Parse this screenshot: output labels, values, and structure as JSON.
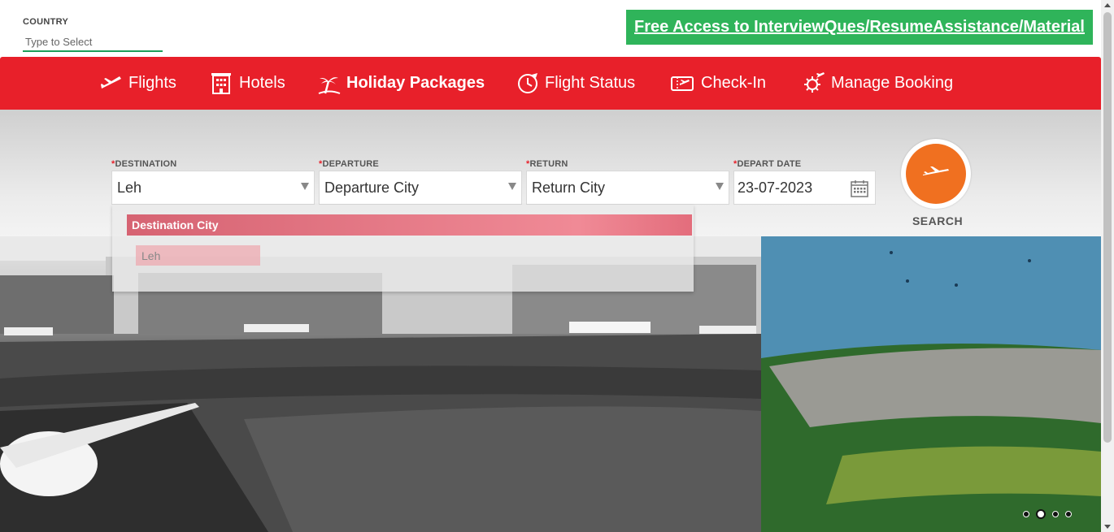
{
  "country": {
    "label": "COUNTRY",
    "placeholder": "Type to Select"
  },
  "promo": {
    "text": "Free Access to InterviewQues/ResumeAssistance/Material"
  },
  "nav": {
    "flights": "Flights",
    "hotels": "Hotels",
    "holiday": "Holiday Packages",
    "flight_status": "Flight Status",
    "checkin": "Check-In",
    "manage": "Manage Booking"
  },
  "form": {
    "destination": {
      "label": "DESTINATION",
      "value": "Leh"
    },
    "departure": {
      "label": "DEPARTURE",
      "value": "Departure City"
    },
    "return": {
      "label": "RETURN",
      "value": "Return City"
    },
    "depart_date": {
      "label": "DEPART DATE",
      "value": "23-07-2023"
    },
    "required_mark": "*",
    "search_label": "SEARCH"
  },
  "dropdown": {
    "header": "Destination City",
    "options": [
      "Leh"
    ]
  },
  "carousel": {
    "slides": 4,
    "active": 2
  },
  "colors": {
    "nav": "#e8202a",
    "promo": "#2fb45a",
    "search": "#f07020"
  }
}
